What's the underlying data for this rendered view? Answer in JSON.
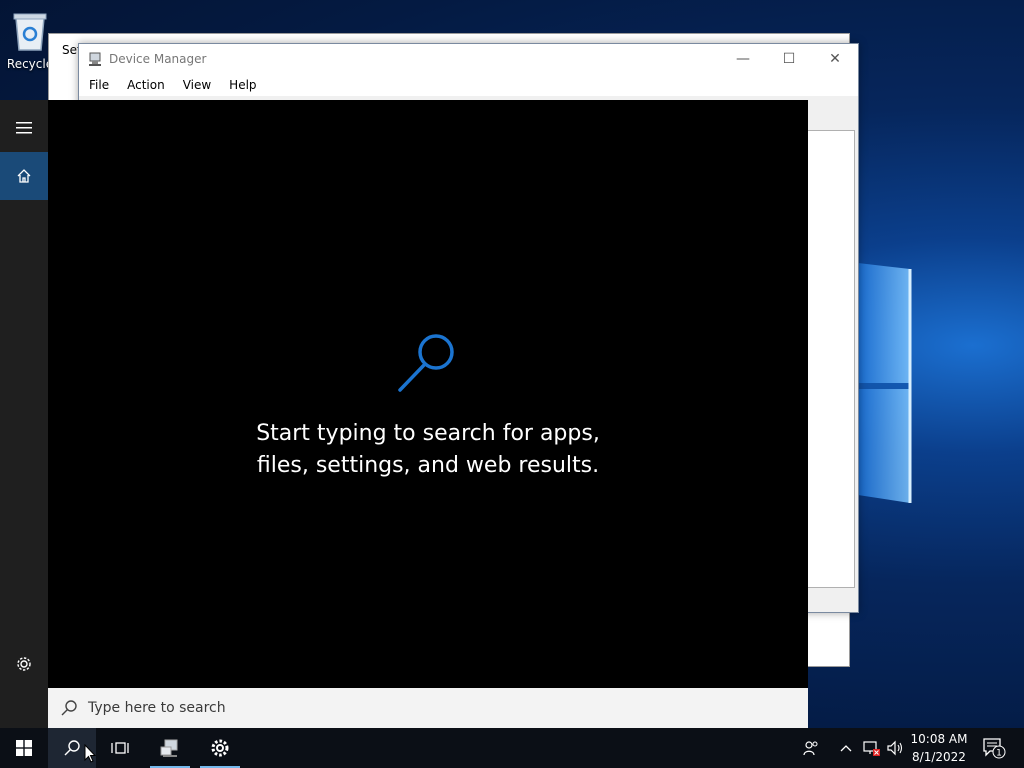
{
  "desktop": {
    "recycle_bin_label": "Recycle"
  },
  "settings_window": {
    "title": "Set"
  },
  "device_manager": {
    "title": "Device Manager",
    "menu": [
      "File",
      "Action",
      "View",
      "Help"
    ],
    "controls": {
      "minimize": "—",
      "maximize": "☐",
      "close": "✕"
    }
  },
  "search_panel": {
    "prompt_line1": "Start typing to search for apps,",
    "prompt_line2": "files, settings, and web results.",
    "search_placeholder": "Type here to search",
    "accent_color": "#1b74d0"
  },
  "taskbar": {
    "clock_time": "10:08 AM",
    "clock_date": "8/1/2022",
    "notification_count": "1",
    "background_color": "#0b0f16"
  }
}
